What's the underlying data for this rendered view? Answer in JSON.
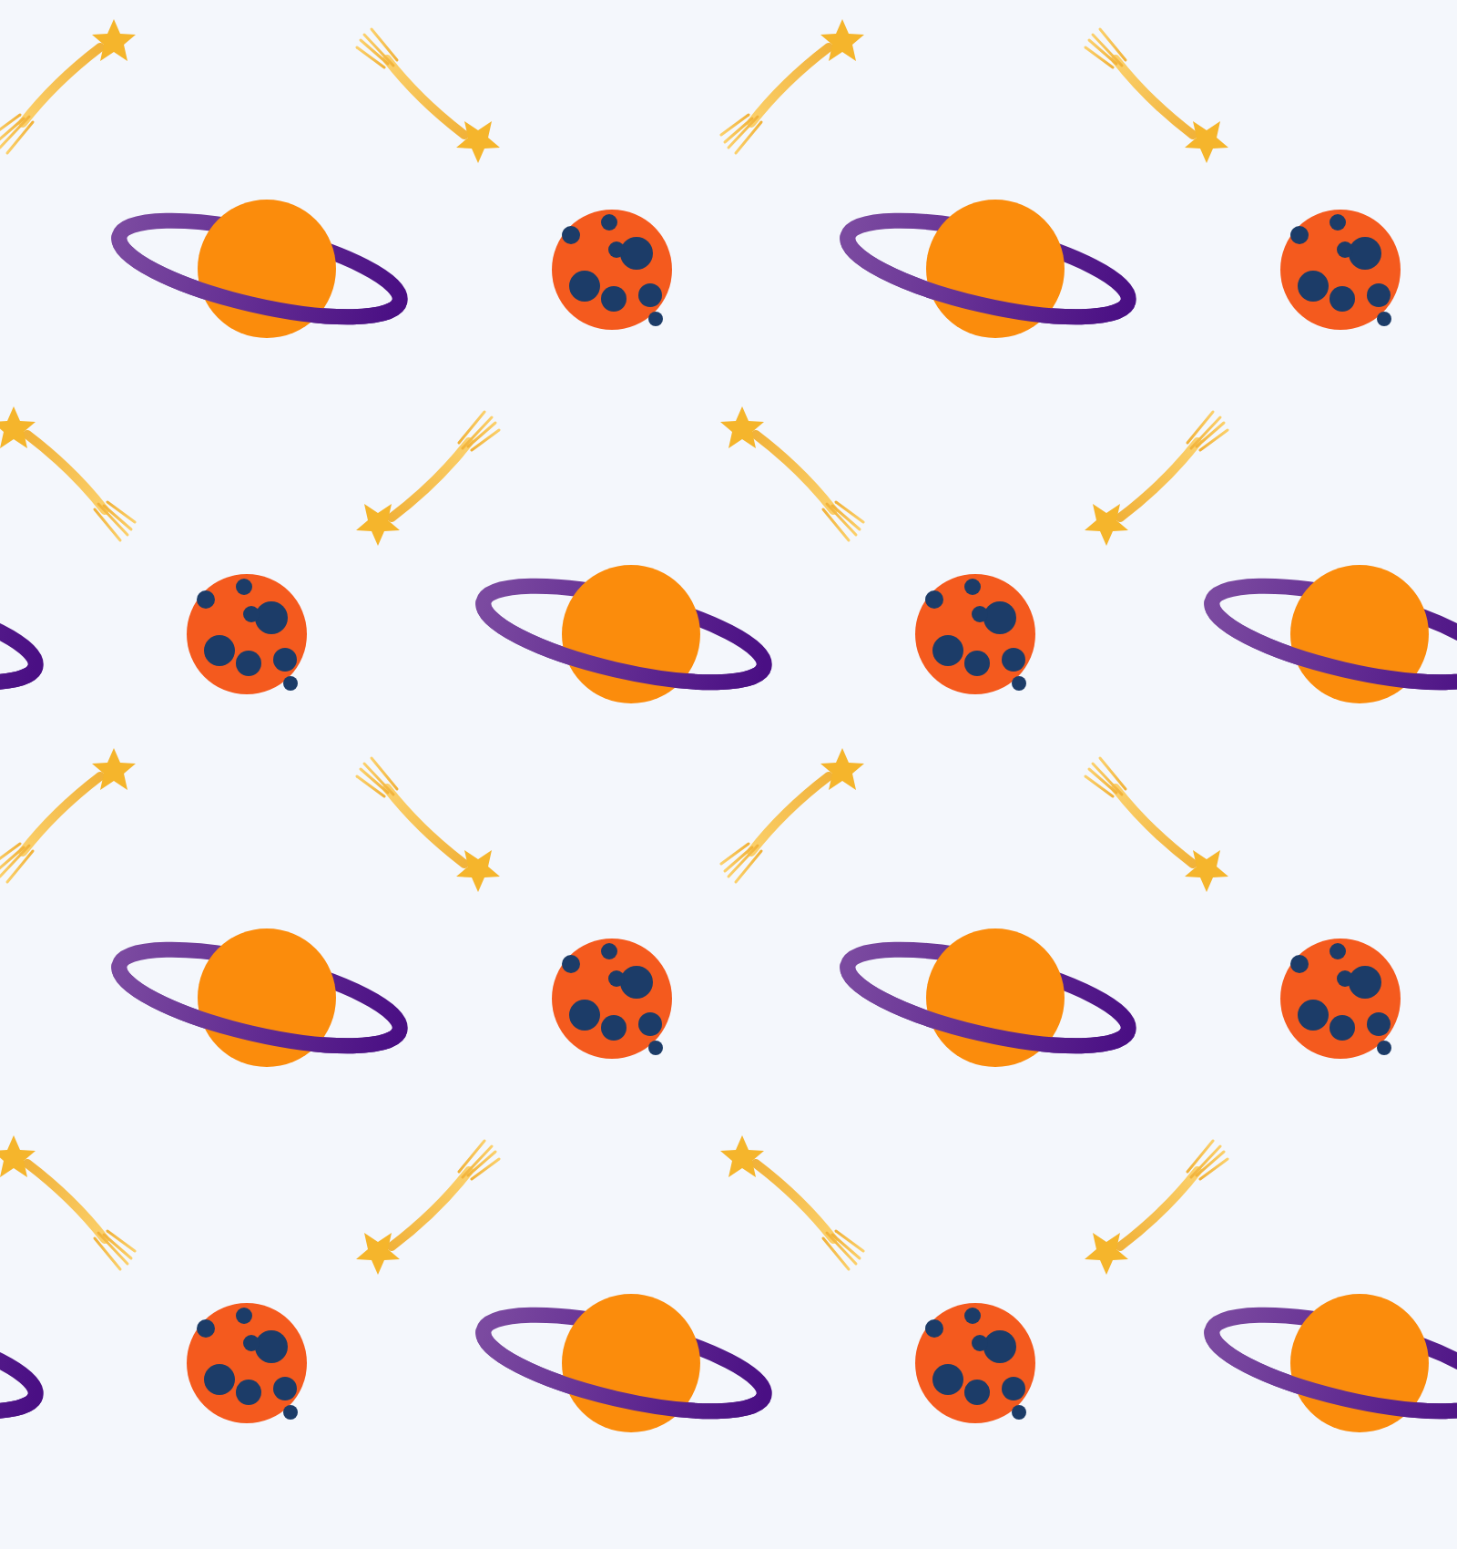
{
  "pattern": {
    "motifs": [
      {
        "kind": "shooting-star"
      },
      {
        "kind": "shooting-star"
      },
      {
        "kind": "ringed-planet"
      },
      {
        "kind": "cratered-planet"
      },
      {
        "kind": "shooting-star"
      },
      {
        "kind": "shooting-star"
      },
      {
        "kind": "cratered-planet"
      },
      {
        "kind": "ringed-planet"
      }
    ]
  }
}
